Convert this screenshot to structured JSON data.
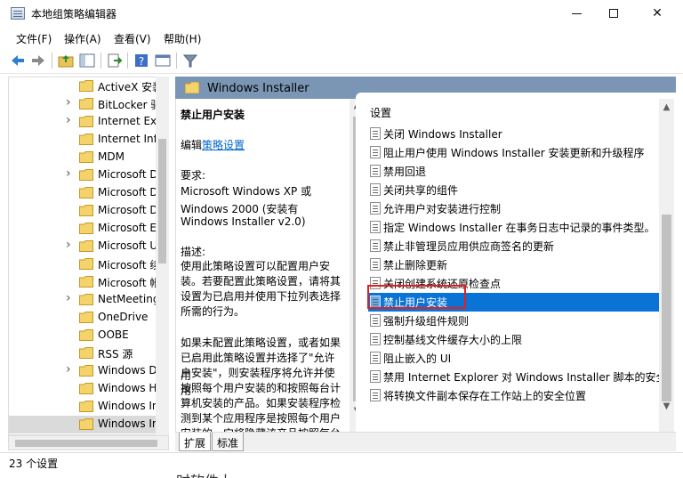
{
  "window": {
    "title": "本地组策略编辑器"
  },
  "menu": [
    "文件(F)",
    "操作(A)",
    "查看(V)",
    "帮助(H)"
  ],
  "tree": {
    "items": [
      {
        "label": "ActiveX 安装",
        "expandable": false
      },
      {
        "label": "BitLocker 驱",
        "expandable": true
      },
      {
        "label": "Internet Exp",
        "expandable": true
      },
      {
        "label": "Internet Inf",
        "expandable": false
      },
      {
        "label": "MDM",
        "expandable": false
      },
      {
        "label": "Microsoft D",
        "expandable": true
      },
      {
        "label": "Microsoft D",
        "expandable": false
      },
      {
        "label": "Microsoft D",
        "expandable": false
      },
      {
        "label": "Microsoft E",
        "expandable": false
      },
      {
        "label": "Microsoft U",
        "expandable": true
      },
      {
        "label": "Microsoft 续",
        "expandable": false
      },
      {
        "label": "Microsoft 帐",
        "expandable": false
      },
      {
        "label": "NetMeeting",
        "expandable": true
      },
      {
        "label": "OneDrive",
        "expandable": false
      },
      {
        "label": "OOBE",
        "expandable": false
      },
      {
        "label": "RSS 源",
        "expandable": false
      },
      {
        "label": "Windows D",
        "expandable": true
      },
      {
        "label": "Windows H",
        "expandable": false
      },
      {
        "label": "Windows In",
        "expandable": false
      },
      {
        "label": "Windows Ir",
        "expandable": false,
        "selected": true
      }
    ]
  },
  "content": {
    "folder_title": "Windows Installer",
    "description": {
      "heading": "禁止用户安装",
      "edit_prefix": "编辑",
      "edit_link": "策略设置",
      "requirements_label": "要求:",
      "requirements_lines": [
        "Microsoft Windows XP 或",
        "Windows 2000 (安装有",
        "Windows Installer v2.0)"
      ],
      "description_label": "描述:",
      "description_lines": [
        "使用此策略设置可以配置用户安",
        "装。若要配置此策略设置，请将其",
        "设置为已启用并使用下拉列表选择",
        "所需的行为。"
      ],
      "more_lines": [
        "如果未配置此策略设置，或者如果",
        "已启用此策略设置并选择了\"允许用",
        "户安装\"，则安装程序将允许并使用",
        "按照每个用户安装的和按照每台计",
        "算机安装的产品。如果安装程序检",
        "测到某个应用程序是按照每个用户",
        "安装的，它将隐藏该产品按照每台"
      ]
    },
    "list": {
      "column_header": "设置",
      "items": [
        "关闭 Windows Installer",
        "阻止用户使用 Windows Installer 安装更新和升级程序",
        "禁用回退",
        "关闭共享的组件",
        "允许用户对安装进行控制",
        "指定 Windows Installer 在事务日志中记录的事件类型。",
        "禁止非管理员应用供应商签名的更新",
        "禁止删除更新",
        "关闭创建系统还原检查点",
        "禁止用户安装",
        "强制升级组件规则",
        "控制基线文件缓存大小的上限",
        "阻止嵌入的 UI",
        "禁用 Internet Explorer 对 Windows Installer 脚本的安全",
        "将转换文件副本保存在工作站上的安全位置"
      ],
      "selected_index": 9
    },
    "tabs": [
      "扩展",
      "标准"
    ]
  },
  "status": {
    "text": "23 个设置",
    "fragment": "时软件上。"
  },
  "colors": {
    "selection": "#0a74d6",
    "header_band": "#7a96b4",
    "highlight_outline": "#e02020",
    "link": "#0066cc"
  }
}
